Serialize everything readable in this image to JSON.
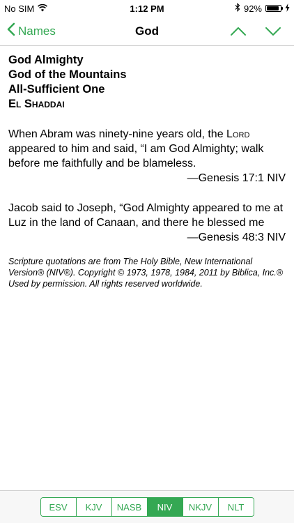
{
  "status_bar": {
    "carrier": "No SIM",
    "time": "1:12 PM",
    "battery_percent": "92%",
    "battery_level": 0.92
  },
  "nav": {
    "back_label": "Names",
    "title": "God"
  },
  "names": {
    "line1": "God Almighty",
    "line2": "God of the Mountains",
    "line3": "All-Sufficient One",
    "line4": "El Shaddai"
  },
  "verses": [
    {
      "text_before": "When Abram was ninety-nine years old, the ",
      "lord": "Lord",
      "text_after": " appeared to him and said, “I am God Almighty; walk before me faithfully and be blameless.",
      "reference": "—Genesis 17:1 NIV"
    },
    {
      "text": "Jacob said to Joseph, “God Almighty appeared to me at Luz in the land of Canaan, and there he blessed me",
      "reference": "—Genesis 48:3 NIV"
    }
  ],
  "copyright": "Scripture quotations are from The Holy Bible, New International Version® (NIV®). Copyright © 1973, 1978, 1984, 2011 by Biblica, Inc.® Used by permission. All rights reserved worldwide.",
  "translations": {
    "items": [
      "ESV",
      "KJV",
      "NASB",
      "NIV",
      "NKJV",
      "NLT"
    ],
    "selected": "NIV"
  },
  "colors": {
    "accent": "#34a853"
  }
}
